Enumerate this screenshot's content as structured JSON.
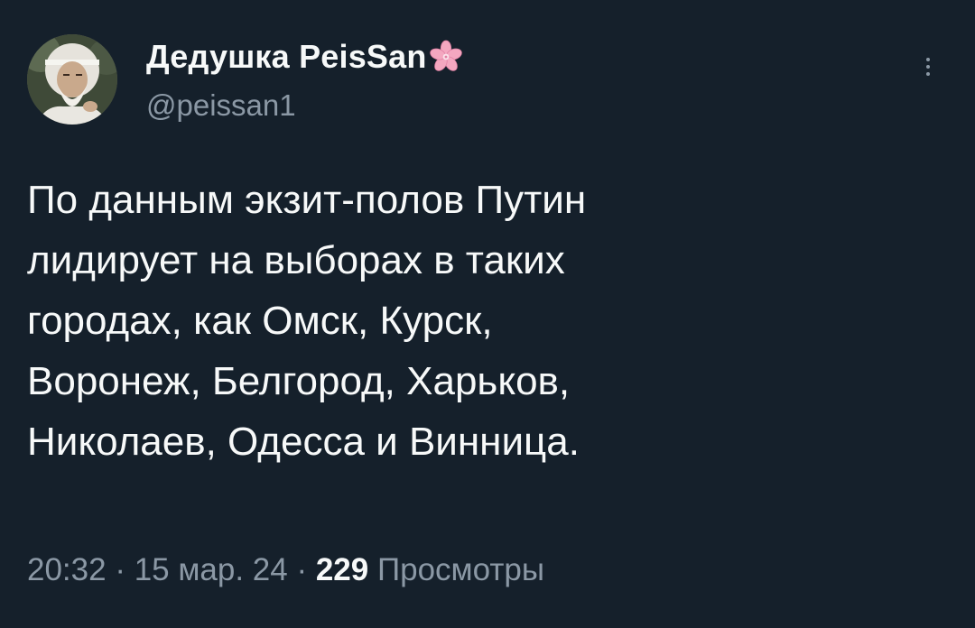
{
  "author": {
    "display_name": "Дедушка PeisSan",
    "handle": "@peissan1",
    "badge_icon": "sakura-flower-icon",
    "badge_color": "#f4a7c0"
  },
  "tweet": {
    "text_lines": [
      "По данным экзит-полов Путин",
      "лидирует на выборах в таких",
      "городах, как Омск, Курск,",
      "Воронеж, Белгород, Харьков,",
      "Николаев, Одесса и Винница."
    ]
  },
  "meta": {
    "time": "20:32",
    "sep1": " · ",
    "date": "15 мар. 24",
    "sep2": " · ",
    "views_count": "229",
    "views_label": " Просмотры"
  },
  "menu": {
    "icon": "more-vertical-icon"
  },
  "colors": {
    "background": "#15202b",
    "primary_text": "#f7f9f9",
    "secondary_text": "#8b98a5"
  }
}
